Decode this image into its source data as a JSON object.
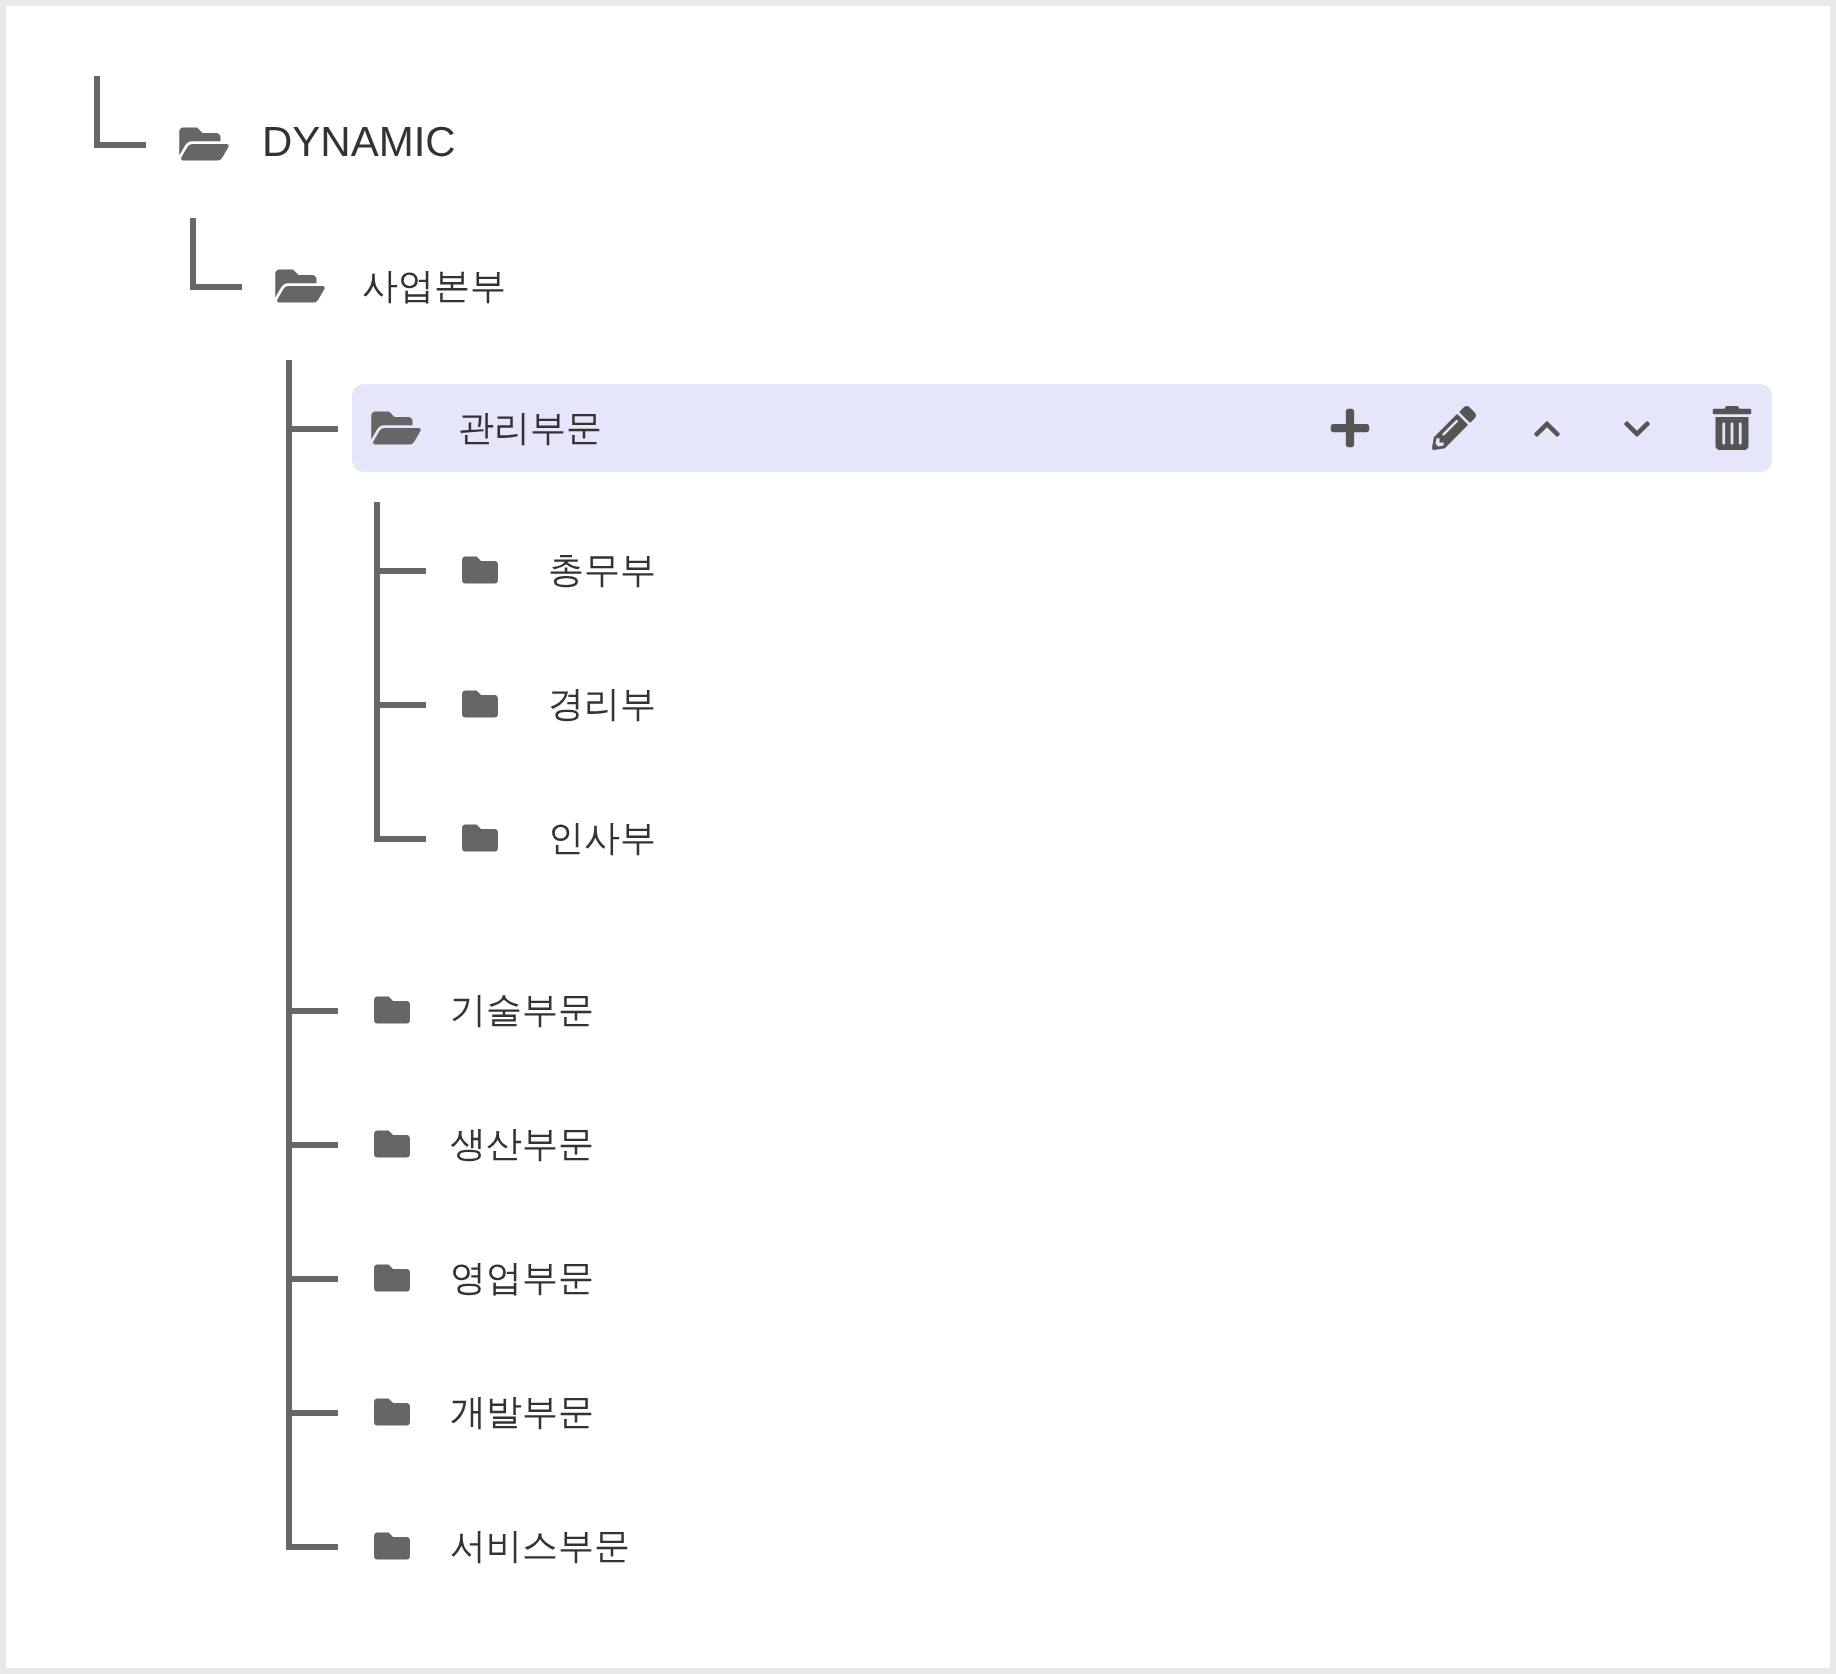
{
  "tree": [
    {
      "label": "DYNAMIC",
      "expanded": true,
      "selected": false,
      "children": [
        {
          "label": "사업본부",
          "expanded": true,
          "selected": false,
          "children": [
            {
              "label": "관리부문",
              "expanded": true,
              "selected": true,
              "children": [
                {
                  "label": "총무부",
                  "expanded": false,
                  "selected": false
                },
                {
                  "label": "경리부",
                  "expanded": false,
                  "selected": false
                },
                {
                  "label": "인사부",
                  "expanded": false,
                  "selected": false
                }
              ]
            },
            {
              "label": "기술부문",
              "expanded": false,
              "selected": false
            },
            {
              "label": "생산부문",
              "expanded": false,
              "selected": false
            },
            {
              "label": "영업부문",
              "expanded": false,
              "selected": false
            },
            {
              "label": "개발부문",
              "expanded": false,
              "selected": false
            },
            {
              "label": "서비스부문",
              "expanded": false,
              "selected": false
            }
          ]
        }
      ]
    }
  ]
}
